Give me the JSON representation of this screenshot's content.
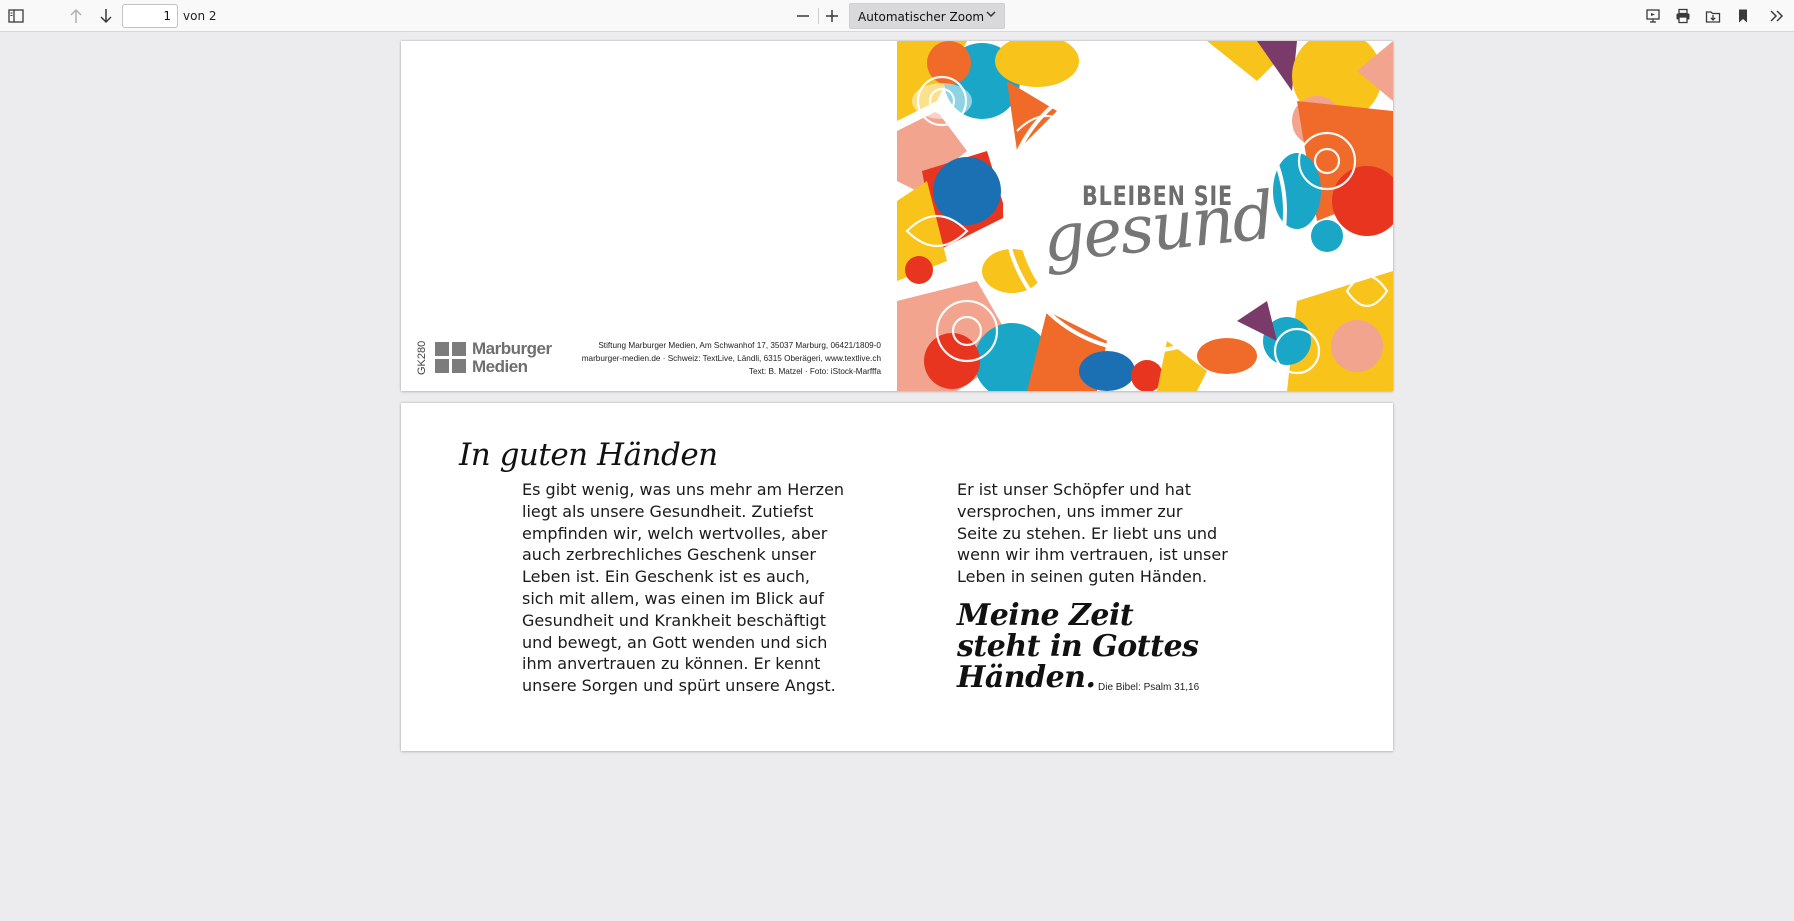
{
  "toolbar": {
    "current_page": "1",
    "page_of": "von 2",
    "zoom_label": "Automatischer Zoom",
    "icons": [
      "sidebar-toggle-icon",
      "arrow-up-icon",
      "arrow-down-icon",
      "minus-icon",
      "plus-icon",
      "chevron-down-icon",
      "presentation-icon",
      "print-icon",
      "save-icon",
      "bookmark-icon",
      "tools-chevron-icon"
    ]
  },
  "page1": {
    "code": "GK280",
    "logo_line1": "Marburger",
    "logo_line2": "Medien",
    "publisher_line1": "Stiftung Marburger Medien, Am Schwanhof 17, 35037 Marburg, 06421/1809-0",
    "publisher_line2": "marburger-medien.de · Schweiz: TextLive, Ländli, 6315 Oberägeri, www.textlive.ch",
    "publisher_line3": "Text: B. Matzel · Foto: iStock-Marfffa",
    "headline_top": "BLEIBEN SIE",
    "headline_script": "gesund",
    "colors": {
      "red": "#e8351f",
      "orange": "#f06a2a",
      "yellow": "#f8c31a",
      "teal": "#1aa6c7",
      "pink": "#f2a48f",
      "purple": "#7a3b6a",
      "blue": "#1b6fb3"
    }
  },
  "page2": {
    "title": "In guten Händen",
    "body_left": "Es gibt wenig, was uns mehr am Herzen\nliegt als unsere Gesundheit. Zutiefst\nempfinden wir, welch wertvolles, aber\nauch zerbrechliches Geschenk unser\nLeben ist. Ein Geschenk ist es auch,\nsich mit allem, was einen im Blick auf\nGesundheit und Krankheit beschäftigt\nund bewegt, an Gott wenden und sich\nihm anvertrauen zu können. Er kennt\nunsere Sorgen und spürt unsere Angst.",
    "body_right": "Er ist unser Schöpfer und hat\nversprochen, uns immer zur\nSeite zu stehen. Er liebt uns und\nwenn wir ihm vertrauen, ist unser\nLeben in seinen guten Händen.",
    "quote": "Meine Zeit\nsteht in Gottes\nHänden.",
    "quote_source": "Die Bibel: Psalm 31,16"
  }
}
